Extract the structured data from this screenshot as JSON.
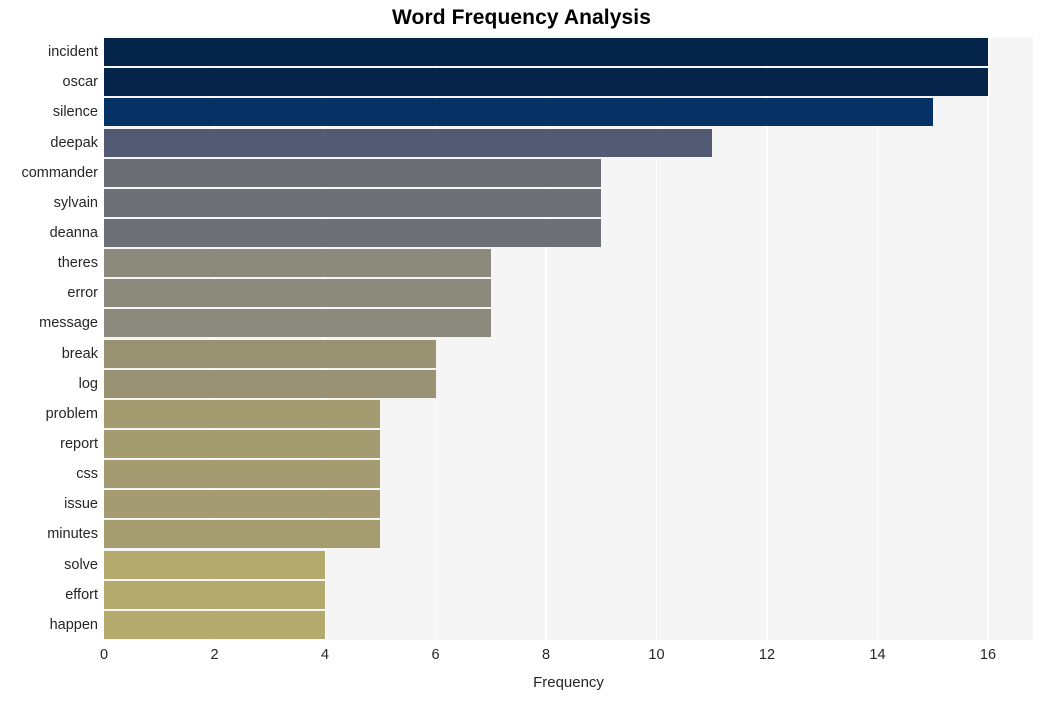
{
  "chart_data": {
    "type": "bar",
    "orientation": "horizontal",
    "title": "Word Frequency Analysis",
    "xlabel": "Frequency",
    "ylabel": "",
    "xlim": [
      0,
      16.8
    ],
    "xticks": [
      0,
      2,
      4,
      6,
      8,
      10,
      12,
      14,
      16
    ],
    "xticklabels": [
      "0",
      "2",
      "4",
      "6",
      "8",
      "10",
      "12",
      "14",
      "16"
    ],
    "grid": "vertical-only",
    "legend": "none",
    "categories": [
      "incident",
      "oscar",
      "silence",
      "deepak",
      "commander",
      "sylvain",
      "deanna",
      "theres",
      "error",
      "message",
      "break",
      "log",
      "problem",
      "report",
      "css",
      "issue",
      "minutes",
      "solve",
      "effort",
      "happen"
    ],
    "values": [
      16,
      16,
      15,
      11,
      9,
      9,
      9,
      7,
      7,
      7,
      6,
      6,
      5,
      5,
      5,
      5,
      5,
      4,
      4,
      4
    ],
    "bar_colors": [
      "#052449",
      "#052449",
      "#043166",
      "#535b73",
      "#6b6d75",
      "#6e7078",
      "#6e7078",
      "#8b8a7c",
      "#8b8a7c",
      "#8b8a7c",
      "#999374",
      "#999374",
      "#a49c70",
      "#a49c70",
      "#a49c70",
      "#a49c70",
      "#a59d70",
      "#b5aa6d",
      "#b5aa6d",
      "#b5aa6d"
    ],
    "plot_background": "#f5f5f6",
    "gridline_color": "#ffffff",
    "figure_background": "#ffffff",
    "text_color": "#262626"
  }
}
